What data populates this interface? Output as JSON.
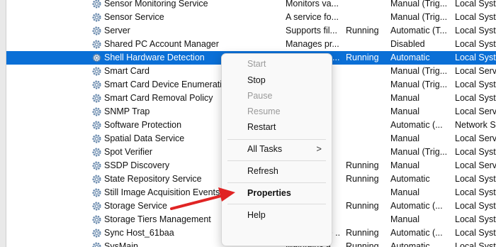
{
  "services": {
    "rows": [
      {
        "name": "Sensor Monitoring Service",
        "desc": "Monitors va...",
        "status": "",
        "startup": "Manual (Trig...",
        "logon": "Local Syste"
      },
      {
        "name": "Sensor Service",
        "desc": "A service fo...",
        "status": "",
        "startup": "Manual (Trig...",
        "logon": "Local Syste"
      },
      {
        "name": "Server",
        "desc": "Supports fil...",
        "status": "Running",
        "startup": "Automatic (T...",
        "logon": "Local Syste"
      },
      {
        "name": "Shared PC Account Manager",
        "desc": "Manages pr...",
        "status": "",
        "startup": "Disabled",
        "logon": "Local Syste"
      },
      {
        "name": "Shell Hardware Detection",
        "desc": "Provides no...",
        "status": "Running",
        "startup": "Automatic",
        "logon": "Local Syste",
        "selected": true
      },
      {
        "name": "Smart Card",
        "desc": "",
        "status": "",
        "startup": "Manual (Trig...",
        "logon": "Local Servic"
      },
      {
        "name": "Smart Card Device Enumeration",
        "desc": "",
        "status": "",
        "startup": "Manual (Trig...",
        "logon": "Local Syste"
      },
      {
        "name": "Smart Card Removal Policy",
        "desc": "",
        "status": "",
        "startup": "Manual",
        "logon": "Local Syste"
      },
      {
        "name": "SNMP Trap",
        "desc": "",
        "status": "",
        "startup": "Manual",
        "logon": "Local Servic"
      },
      {
        "name": "Software Protection",
        "desc": "",
        "status": "",
        "startup": "Automatic (...",
        "logon": "Network S..."
      },
      {
        "name": "Spatial Data Service",
        "desc": "",
        "status": "",
        "startup": "Manual",
        "logon": "Local Servic"
      },
      {
        "name": "Spot Verifier",
        "desc": "",
        "status": "",
        "startup": "Manual (Trig...",
        "logon": "Local Syste"
      },
      {
        "name": "SSDP Discovery",
        "desc": "",
        "status": "Running",
        "startup": "Manual",
        "logon": "Local Servic"
      },
      {
        "name": "State Repository Service",
        "desc": "",
        "status": "Running",
        "startup": "Automatic",
        "logon": "Local Syste"
      },
      {
        "name": "Still Image Acquisition Events",
        "desc": "",
        "status": "",
        "startup": "Manual",
        "logon": "Local Syste"
      },
      {
        "name": "Storage Service",
        "desc": "",
        "status": "Running",
        "startup": "Automatic (...",
        "logon": "Local Syste"
      },
      {
        "name": "Storage Tiers Management",
        "desc": "",
        "status": "",
        "startup": "Manual",
        "logon": "Local Syste"
      },
      {
        "name": "Sync Host_61baa",
        "desc": "This service ...",
        "status": "Running",
        "startup": "Automatic (...",
        "logon": "Local Syste"
      },
      {
        "name": "SysMain",
        "desc": "Maintains a...",
        "status": "Running",
        "startup": "Automatic",
        "logon": "Local Syste"
      }
    ]
  },
  "context_menu": {
    "items": [
      {
        "label": "Start",
        "enabled": false
      },
      {
        "label": "Stop",
        "enabled": true
      },
      {
        "label": "Pause",
        "enabled": false
      },
      {
        "label": "Resume",
        "enabled": false
      },
      {
        "label": "Restart",
        "enabled": true
      },
      {
        "label": "All Tasks",
        "enabled": true,
        "submenu": true
      },
      {
        "label": "Refresh",
        "enabled": true
      },
      {
        "label": "Properties",
        "enabled": true,
        "bold": true
      },
      {
        "label": "Help",
        "enabled": true
      }
    ],
    "submenu_arrow": ">"
  },
  "annotation": {
    "pointer_color": "#e02424",
    "points_to": "Properties"
  },
  "colors": {
    "selection": "#0a6fd6",
    "gear": "#5b7fa6"
  }
}
